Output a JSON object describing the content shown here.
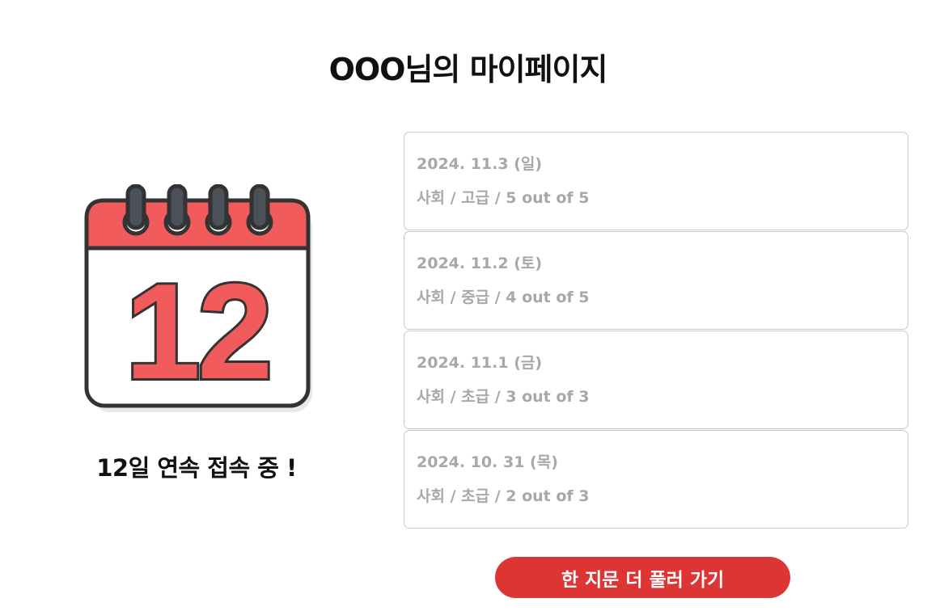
{
  "header": {
    "title": "OOO님의 마이페이지"
  },
  "streak": {
    "calendar_number": "12",
    "text": "12일 연속 접속 중 !",
    "colors": {
      "calendar_red": "#f25b5b",
      "ring": "#4a5158",
      "outline": "#333333"
    }
  },
  "history": [
    {
      "date": "2024. 11.3 (일)",
      "detail": "사회 / 고급 / 5 out of 5"
    },
    {
      "date": "2024. 11.2 (토)",
      "detail": "사회 / 중급 / 4 out of 5"
    },
    {
      "date": "2024. 11.1 (금)",
      "detail": "사회 / 초급 / 3 out of 3"
    },
    {
      "date": "2024. 10. 31 (목)",
      "detail": "사회 / 초급 / 2 out of 3"
    }
  ],
  "actions": {
    "solve_more_label": "한 지문 더 풀러 가기",
    "button_color": "#dd3434"
  }
}
